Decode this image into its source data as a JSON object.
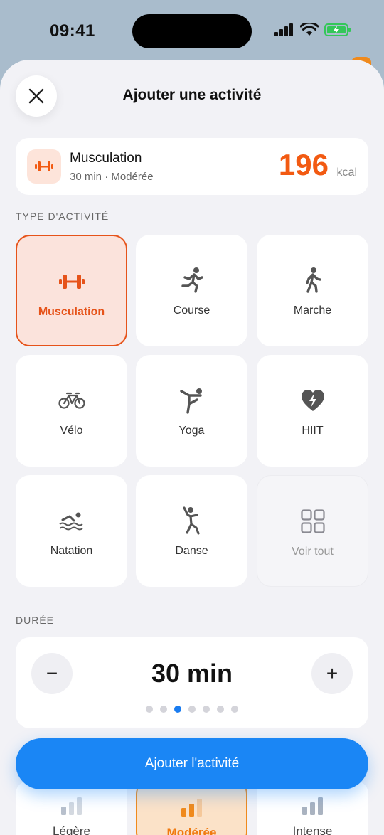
{
  "status_bar": {
    "time": "09:41"
  },
  "header": {
    "title": "Ajouter une activité"
  },
  "summary": {
    "name": "Musculation",
    "subtitle": "30 min · Modérée",
    "kcal_value": "196",
    "kcal_unit": "kcal"
  },
  "activity_types": {
    "label": "TYPE D'ACTIVITÉ",
    "items": [
      {
        "label": "Musculation",
        "icon": "dumbbell-icon",
        "selected": true
      },
      {
        "label": "Course",
        "icon": "running-icon"
      },
      {
        "label": "Marche",
        "icon": "walking-icon"
      },
      {
        "label": "Vélo",
        "icon": "bicycle-icon"
      },
      {
        "label": "Yoga",
        "icon": "yoga-icon"
      },
      {
        "label": "HIIT",
        "icon": "heart-bolt-icon"
      },
      {
        "label": "Natation",
        "icon": "swimming-icon"
      },
      {
        "label": "Danse",
        "icon": "dance-icon"
      },
      {
        "label": "Voir tout",
        "icon": "grid-icon"
      }
    ]
  },
  "duration": {
    "label": "DURÉE",
    "value": "30 min",
    "decrement": "−",
    "increment": "+",
    "dots_total": 7,
    "dots_active_index": 2
  },
  "intensity": {
    "items": [
      {
        "label": "Légère"
      },
      {
        "label": "Modérée",
        "selected": true
      },
      {
        "label": "Intense"
      }
    ]
  },
  "cta": {
    "label": "Ajouter l'activité"
  },
  "colors": {
    "accent": "#f25a12",
    "primary": "#1a86f5",
    "selected_border": "#e6531a"
  }
}
